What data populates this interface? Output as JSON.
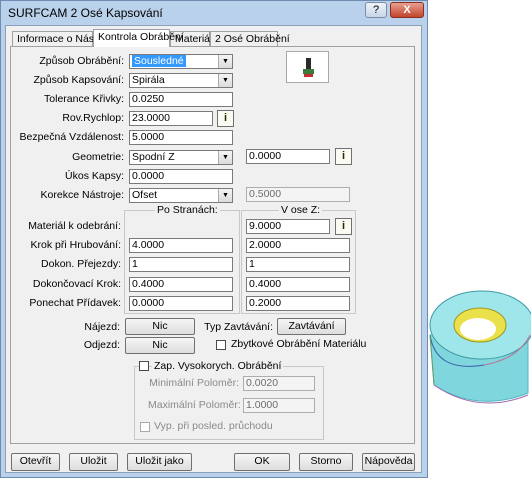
{
  "window": {
    "title": "SURFCAM 2 Osé Kapsování",
    "help_btn": "?",
    "close_btn": "X"
  },
  "tabs": [
    {
      "label": "Informace o Nástroji"
    },
    {
      "label": "Kontrola Obrábění"
    },
    {
      "label": "Materiál"
    },
    {
      "label": "2 Osé Obrábění"
    }
  ],
  "fields": {
    "zpusob_obrabeni": {
      "label": "Způsob Obrábění:",
      "value": "Sousledné"
    },
    "zpusob_kapsovani": {
      "label": "Způsob Kapsování:",
      "value": "Spirála"
    },
    "tolerance": {
      "label": "Tolerance Křivky:",
      "value": "0.0250"
    },
    "rov_rychlop": {
      "label": "Rov.Rychlop:",
      "value": "23.0000"
    },
    "bezpecna": {
      "label": "Bezpečná Vzdálenost:",
      "value": "5.0000"
    },
    "geometrie": {
      "label": "Geometrie:",
      "value": "Spodní Z",
      "extra": "0.0000"
    },
    "ukos": {
      "label": "Úkos Kapsy:",
      "value": "0.0000"
    },
    "korekce": {
      "label": "Korekce Nástroje:",
      "value": "Ofset",
      "extra": "0.5000"
    }
  },
  "grid": {
    "col_stranach": "Po Stranách:",
    "col_ose_z": "V ose Z:",
    "rows": [
      {
        "label": "Materiál k odebrání:",
        "side": "",
        "z": "9.0000"
      },
      {
        "label": "Krok při Hrubování:",
        "side": "4.0000",
        "z": "2.0000"
      },
      {
        "label": "Dokon. Přejezdy:",
        "side": "1",
        "z": "1"
      },
      {
        "label": "Dokončovací Krok:",
        "side": "0.4000",
        "z": "0.4000"
      },
      {
        "label": "Ponechat Přídavek:",
        "side": "0.0000",
        "z": "0.2000"
      }
    ]
  },
  "najezd": {
    "label": "Nájezd:",
    "button": "Nic"
  },
  "odjezd": {
    "label": "Odjezd:",
    "button": "Nic"
  },
  "typ_zavtavani": {
    "label": "Typ Zavtávání:",
    "button": "Zavtávání"
  },
  "zbytkove": {
    "label": "Zbytkové Obrábění Materiálu"
  },
  "hsm": {
    "label": "Zap. Vysokorych. Obrábění",
    "min_label": "Minimální Poloměr:",
    "min_value": "0.0020",
    "max_label": "Maximální Poloměr:",
    "max_value": "1.0000",
    "vyp_label": "Vyp. při posled. průchodu"
  },
  "footer": {
    "open": "Otevřít",
    "save": "Uložit",
    "save_as": "Uložit jako",
    "ok": "OK",
    "cancel": "Storno",
    "help": "Nápověda"
  },
  "pick_glyph": "i"
}
